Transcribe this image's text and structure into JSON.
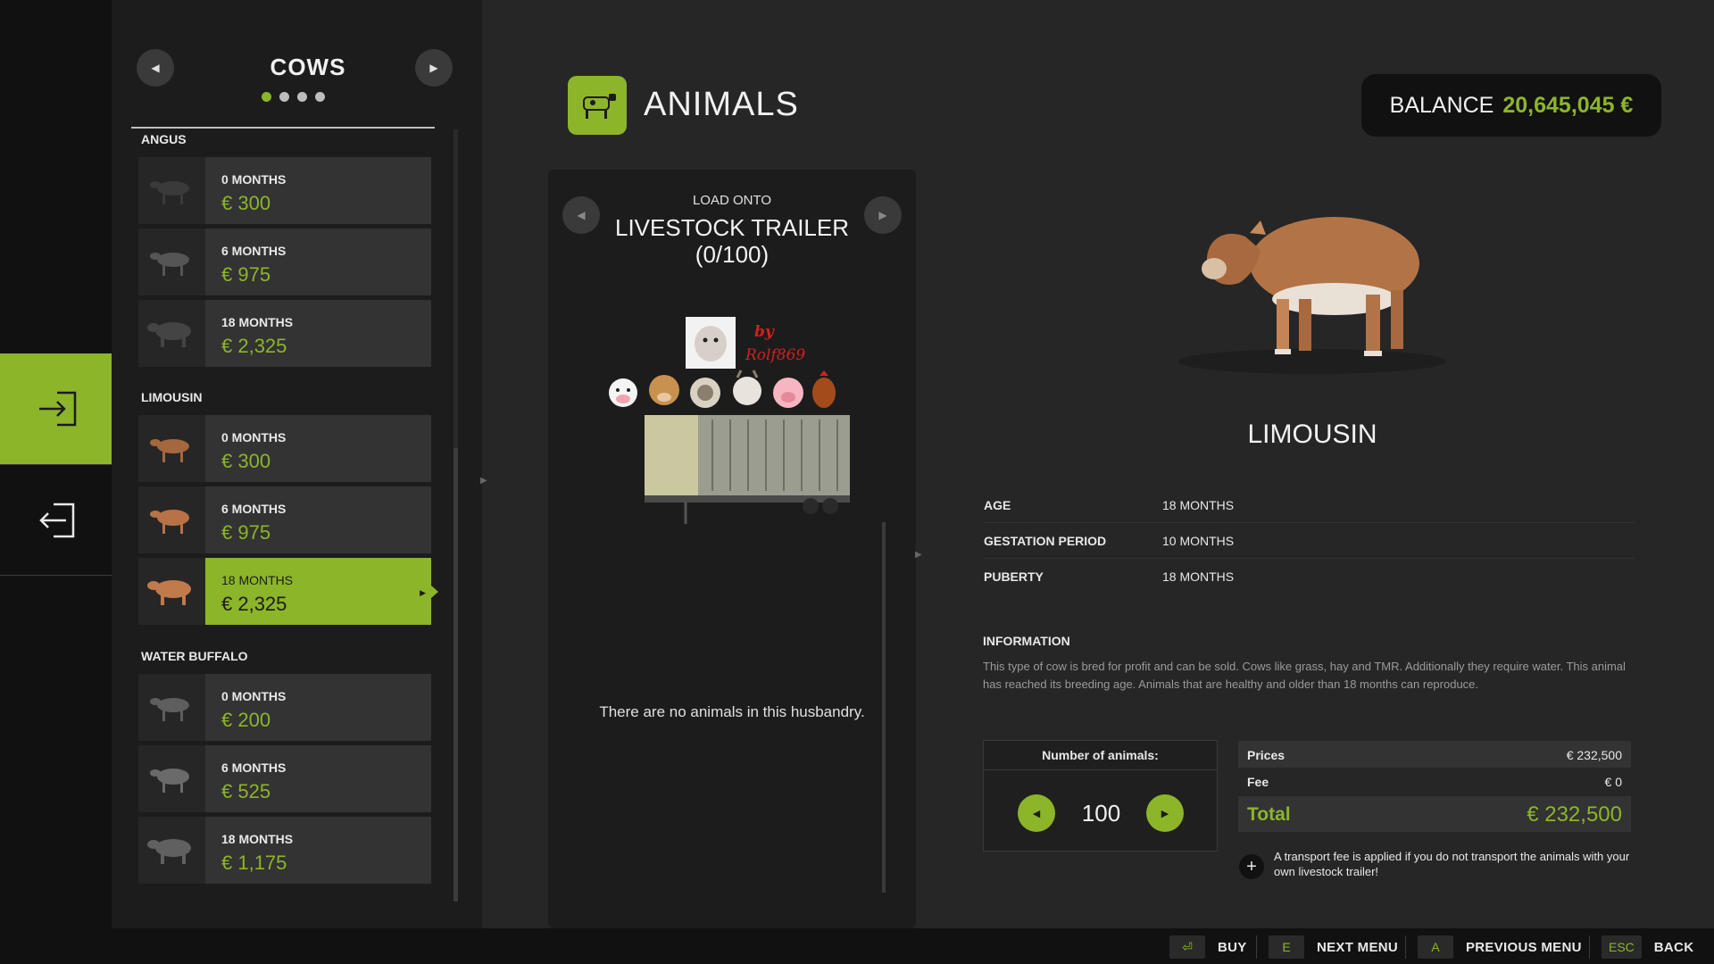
{
  "shop": {
    "category_title": "COWS",
    "pages": 4,
    "active_page": 0,
    "groups": [
      {
        "title": "ANGUS",
        "items": [
          {
            "age": "0 MONTHS",
            "price": "€ 300"
          },
          {
            "age": "6 MONTHS",
            "price": "€ 975"
          },
          {
            "age": "18 MONTHS",
            "price": "€ 2,325"
          }
        ]
      },
      {
        "title": "LIMOUSIN",
        "items": [
          {
            "age": "0 MONTHS",
            "price": "€ 300"
          },
          {
            "age": "6 MONTHS",
            "price": "€ 975"
          },
          {
            "age": "18 MONTHS",
            "price": "€ 2,325",
            "selected": true
          }
        ]
      },
      {
        "title": "WATER BUFFALO",
        "items": [
          {
            "age": "0 MONTHS",
            "price": "€ 200"
          },
          {
            "age": "6 MONTHS",
            "price": "€ 525"
          },
          {
            "age": "18 MONTHS",
            "price": "€ 1,175"
          }
        ]
      }
    ]
  },
  "header": {
    "title": "ANIMALS",
    "balance_label": "BALANCE",
    "balance_value": "20,645,045 €"
  },
  "trailer": {
    "load_label": "LOAD ONTO",
    "name": "LIVESTOCK TRAILER",
    "count": "(0/100)",
    "mod_author_line1": "by",
    "mod_author_line2": "Rolf869",
    "empty_message": "There are no animals in this husbandry."
  },
  "detail": {
    "breed": "LIMOUSIN",
    "attributes": [
      {
        "label": "AGE",
        "value": "18 MONTHS"
      },
      {
        "label": "GESTATION PERIOD",
        "value": "10 MONTHS"
      },
      {
        "label": "PUBERTY",
        "value": "18 MONTHS"
      }
    ],
    "info_title": "INFORMATION",
    "info_text": "This type of cow is bred for profit and can be sold. Cows like grass, hay and TMR. Additionally they require water. This animal has reached its breeding age. Animals that are healthy and older than 18 months can reproduce."
  },
  "purchase": {
    "qty_label": "Number of animals:",
    "qty_value": "100",
    "prices_label": "Prices",
    "prices_value": "€ 232,500",
    "fee_label": "Fee",
    "fee_value": "€ 0",
    "total_label": "Total",
    "total_value": "€ 232,500",
    "fee_note": "A transport fee is applied if you do not transport the animals with your own livestock trailer!"
  },
  "footer": {
    "buy_key": "⏎",
    "buy_label": "BUY",
    "next_key": "E",
    "next_label": "NEXT MENU",
    "prev_key": "A",
    "prev_label": "PREVIOUS MENU",
    "back_key": "ESC",
    "back_label": "BACK"
  },
  "colors": {
    "accent": "#8cb52a",
    "background": "#262626",
    "panel": "#1c1c1c"
  }
}
